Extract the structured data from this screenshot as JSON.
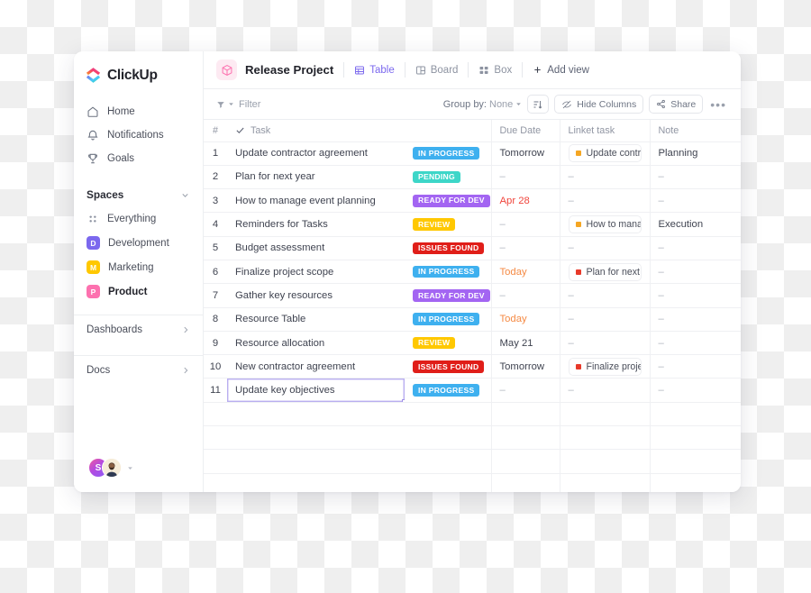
{
  "brand": {
    "name": "ClickUp"
  },
  "sidebar": {
    "nav": [
      {
        "label": "Home",
        "icon": "home-icon"
      },
      {
        "label": "Notifications",
        "icon": "bell-icon"
      },
      {
        "label": "Goals",
        "icon": "trophy-icon"
      }
    ],
    "spaces_title": "Spaces",
    "spaces": [
      {
        "label": "Everything",
        "icon": "grid-dots-icon",
        "badge": null,
        "color": null,
        "active": false
      },
      {
        "label": "Development",
        "badge": "D",
        "color": "#7b68ee",
        "active": false
      },
      {
        "label": "Marketing",
        "badge": "M",
        "color": "#ffc800",
        "active": false
      },
      {
        "label": "Product",
        "badge": "P",
        "color": "#fd71af",
        "active": true
      }
    ],
    "footer": [
      {
        "label": "Dashboards"
      },
      {
        "label": "Docs"
      }
    ],
    "avatars": [
      {
        "initial": "S",
        "type": "initial"
      },
      {
        "initial": "",
        "type": "photo"
      }
    ]
  },
  "header": {
    "project_icon": "box-cube-icon",
    "title": "Release Project",
    "views": [
      {
        "label": "Table",
        "icon": "table-icon",
        "active": true
      },
      {
        "label": "Board",
        "icon": "board-icon",
        "active": false
      },
      {
        "label": "Box",
        "icon": "box-view-icon",
        "active": false
      }
    ],
    "add_view": "Add view"
  },
  "toolbar": {
    "filter": "Filter",
    "group_by_label": "Group by:",
    "group_by_value": "None",
    "sort_icon": "sort-icon",
    "hide_columns": "Hide Columns",
    "share": "Share",
    "more": "•••"
  },
  "table": {
    "columns": [
      {
        "key": "num",
        "label": "#"
      },
      {
        "key": "task",
        "label": "Task"
      },
      {
        "key": "status",
        "label": ""
      },
      {
        "key": "due",
        "label": "Due Date"
      },
      {
        "key": "linked",
        "label": "Linket task"
      },
      {
        "key": "note",
        "label": "Note"
      }
    ],
    "status_colors": {
      "IN PROGRESS": "#3eb0ef",
      "PENDING": "#3dd6c8",
      "READY FOR DEV": "#a365f2",
      "REVIEW": "#ffc801",
      "ISSUES FOUND": "#e01e19"
    },
    "rows": [
      {
        "num": "1",
        "task": "Update contractor agreement",
        "status": "IN PROGRESS",
        "due": "Tomorrow",
        "due_style": "normal",
        "linked": "Update contr…",
        "linked_dot": "#f5a623",
        "note": "Planning"
      },
      {
        "num": "2",
        "task": "Plan for next year",
        "status": "PENDING",
        "due": "–",
        "due_style": "dash",
        "linked": "–",
        "linked_dot": null,
        "note": "–"
      },
      {
        "num": "3",
        "task": "How to manage event planning",
        "status": "READY FOR DEV",
        "due": "Apr 28",
        "due_style": "red",
        "linked": "–",
        "linked_dot": null,
        "note": "–"
      },
      {
        "num": "4",
        "task": "Reminders for Tasks",
        "status": "REVIEW",
        "due": "–",
        "due_style": "dash",
        "linked": "How to mana…",
        "linked_dot": "#f5a623",
        "note": "Execution"
      },
      {
        "num": "5",
        "task": "Budget assessment",
        "status": "ISSUES FOUND",
        "due": "–",
        "due_style": "dash",
        "linked": "–",
        "linked_dot": null,
        "note": "–"
      },
      {
        "num": "6",
        "task": "Finalize project scope",
        "status": "IN PROGRESS",
        "due": "Today",
        "due_style": "orange",
        "linked": "Plan for next…",
        "linked_dot": "#e8392a",
        "note": "–"
      },
      {
        "num": "7",
        "task": "Gather key resources",
        "status": "READY FOR DEV",
        "due": "–",
        "due_style": "dash",
        "linked": "–",
        "linked_dot": null,
        "note": "–"
      },
      {
        "num": "8",
        "task": "Resource Table",
        "status": "IN PROGRESS",
        "due": "Today",
        "due_style": "orange",
        "linked": "–",
        "linked_dot": null,
        "note": "–"
      },
      {
        "num": "9",
        "task": "Resource allocation",
        "status": "REVIEW",
        "due": "May 21",
        "due_style": "normal",
        "linked": "–",
        "linked_dot": null,
        "note": "–"
      },
      {
        "num": "10",
        "task": "New contractor agreement",
        "status": "ISSUES FOUND",
        "due": "Tomorrow",
        "due_style": "normal",
        "linked": "Finalize proje…",
        "linked_dot": "#e8392a",
        "note": "–"
      },
      {
        "num": "11",
        "task": "Update key objectives",
        "status": "IN PROGRESS",
        "due": "–",
        "due_style": "dash",
        "linked": "–",
        "linked_dot": null,
        "note": "–",
        "selected": true
      }
    ]
  },
  "accent": {
    "primary": "#7b68ee",
    "pink": "#fd71af"
  }
}
